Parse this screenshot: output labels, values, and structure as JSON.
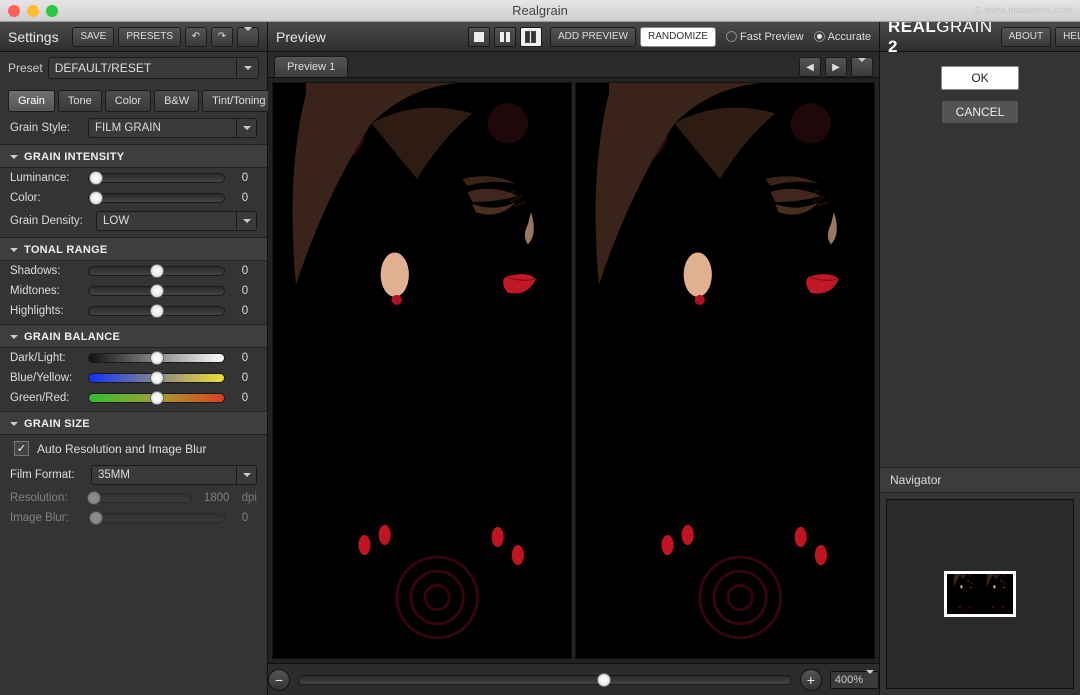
{
  "window": {
    "title": "Realgrain",
    "watermark": "© www.imakewm.com"
  },
  "left": {
    "header": "Settings",
    "save": "SAVE",
    "presets": "PRESETS",
    "preset_label": "Preset",
    "preset_value": "DEFAULT/RESET",
    "tabs": [
      "Grain",
      "Tone",
      "Color",
      "B&W",
      "Tint/Toning"
    ],
    "active_tab": 0,
    "grain_style_label": "Grain Style:",
    "grain_style_value": "FILM GRAIN",
    "sections": {
      "intensity": {
        "title": "GRAIN INTENSITY",
        "luminance": {
          "label": "Luminance:",
          "value": 0
        },
        "color": {
          "label": "Color:",
          "value": 0
        },
        "density_label": "Grain Density:",
        "density_value": "LOW"
      },
      "tonal": {
        "title": "TONAL RANGE",
        "shadows": {
          "label": "Shadows:",
          "value": 0
        },
        "midtones": {
          "label": "Midtones:",
          "value": 0
        },
        "highlights": {
          "label": "Highlights:",
          "value": 0
        }
      },
      "balance": {
        "title": "GRAIN BALANCE",
        "darklight": {
          "label": "Dark/Light:",
          "value": 0
        },
        "blueyellow": {
          "label": "Blue/Yellow:",
          "value": 0
        },
        "greenred": {
          "label": "Green/Red:",
          "value": 0
        }
      },
      "size": {
        "title": "GRAIN SIZE",
        "auto_label": "Auto Resolution and Image Blur",
        "auto_checked": true,
        "film_format_label": "Film Format:",
        "film_format_value": "35MM",
        "resolution_label": "Resolution:",
        "resolution_value": 1800,
        "resolution_unit": "dpi",
        "blur_label": "Image Blur:",
        "blur_value": 0
      }
    }
  },
  "preview": {
    "header": "Preview",
    "add_preview": "ADD PREVIEW",
    "randomize": "RANDOMIZE",
    "fast": "Fast Preview",
    "accurate": "Accurate",
    "accurate_on": true,
    "tabs": [
      "Preview 1"
    ],
    "zoom": "400%"
  },
  "right": {
    "brand_a": "REAL",
    "brand_b": "GRAIN",
    "brand_n": "2",
    "about": "ABOUT",
    "help": "HELP",
    "ok": "OK",
    "cancel": "CANCEL",
    "navigator": "Navigator"
  }
}
